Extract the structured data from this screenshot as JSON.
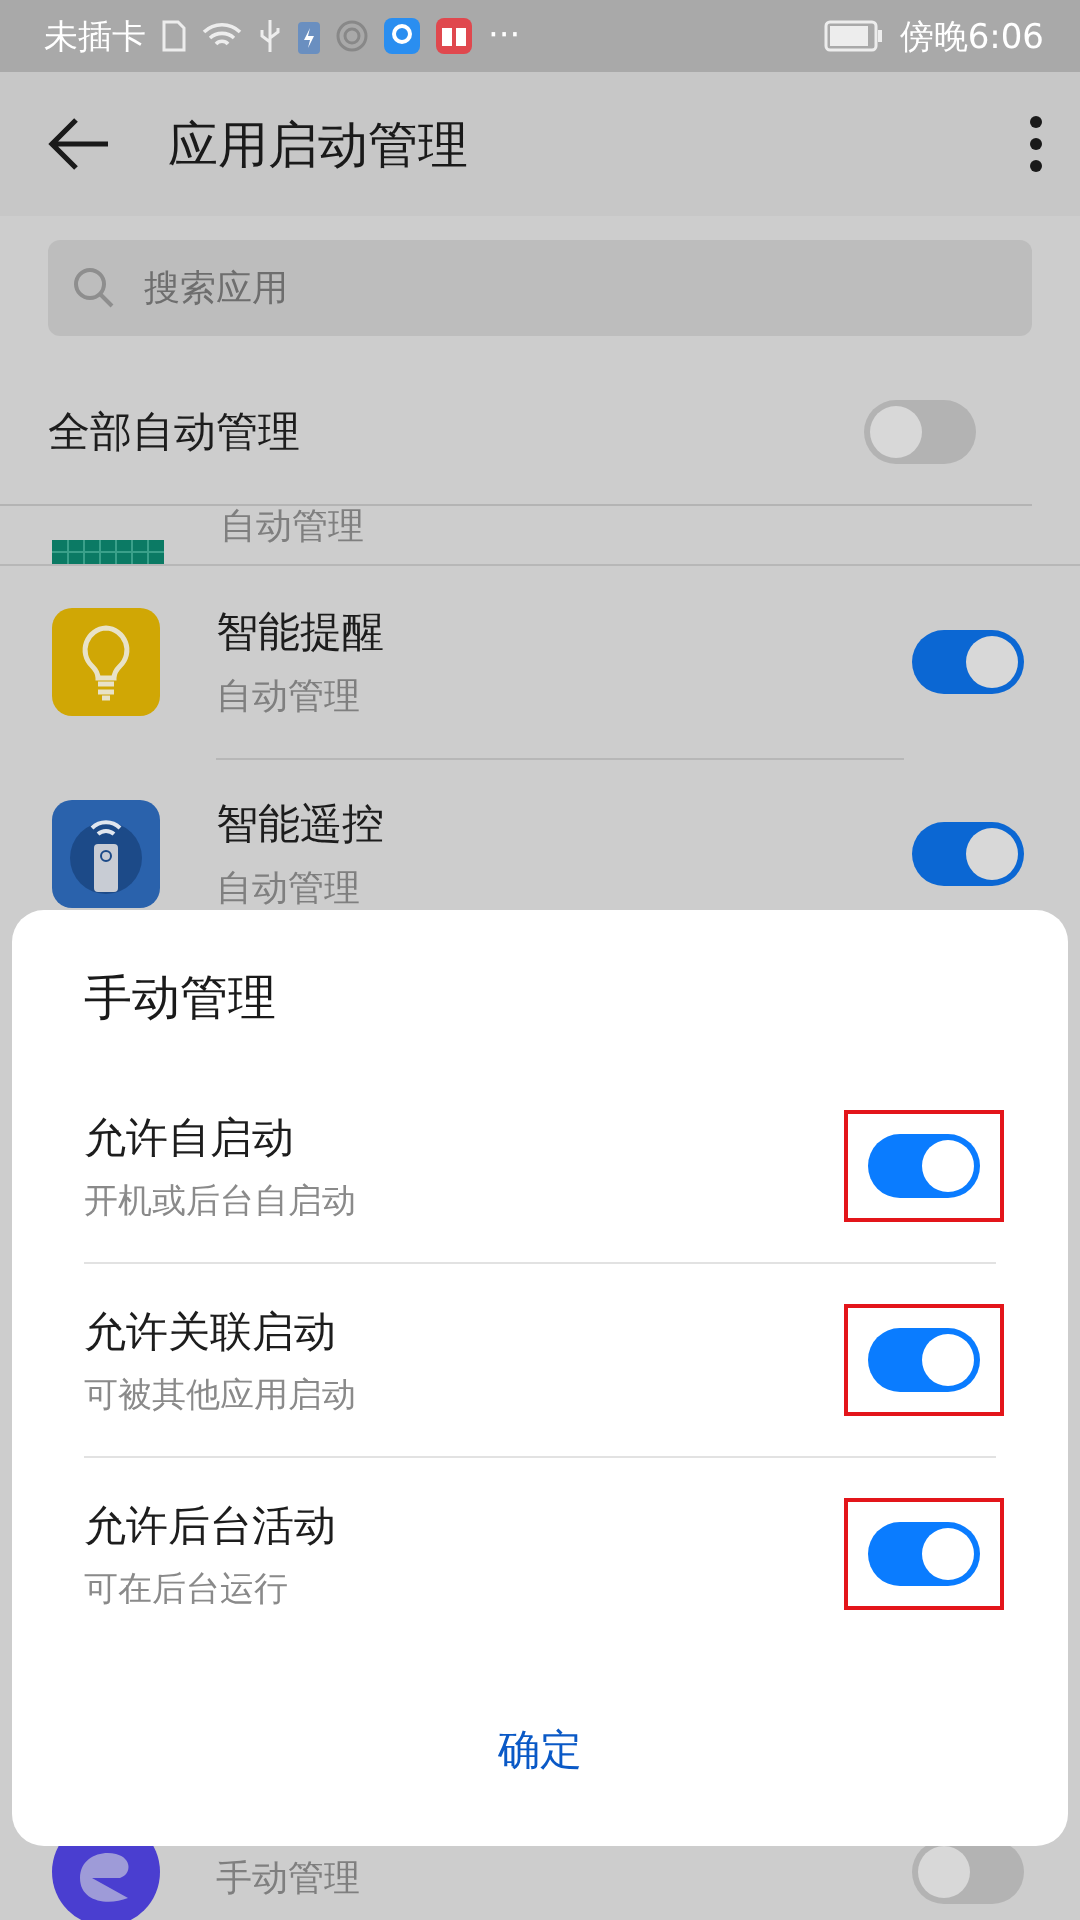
{
  "status_bar": {
    "carrier": "未插卡",
    "more": "···",
    "time": "傍晚6:06"
  },
  "header": {
    "title": "应用启动管理"
  },
  "search": {
    "placeholder": "搜索应用"
  },
  "all_auto": {
    "label": "全部自动管理",
    "on": false
  },
  "apps": [
    {
      "kind": "grid",
      "subtitle": "自动管理"
    },
    {
      "kind": "bulb",
      "name": "智能提醒",
      "subtitle": "自动管理",
      "on": true
    },
    {
      "kind": "remote",
      "name": "智能遥控",
      "subtitle": "自动管理",
      "on": true
    },
    {
      "kind": "fox",
      "subtitle": "手动管理",
      "on": false
    }
  ],
  "dialog": {
    "title": "手动管理",
    "options": [
      {
        "title": "允许自启动",
        "subtitle": "开机或后台自启动",
        "on": true,
        "highlighted": true
      },
      {
        "title": "允许关联启动",
        "subtitle": "可被其他应用启动",
        "on": true,
        "highlighted": true
      },
      {
        "title": "允许后台活动",
        "subtitle": "可在后台运行",
        "on": true,
        "highlighted": true
      }
    ],
    "confirm": "确定"
  }
}
